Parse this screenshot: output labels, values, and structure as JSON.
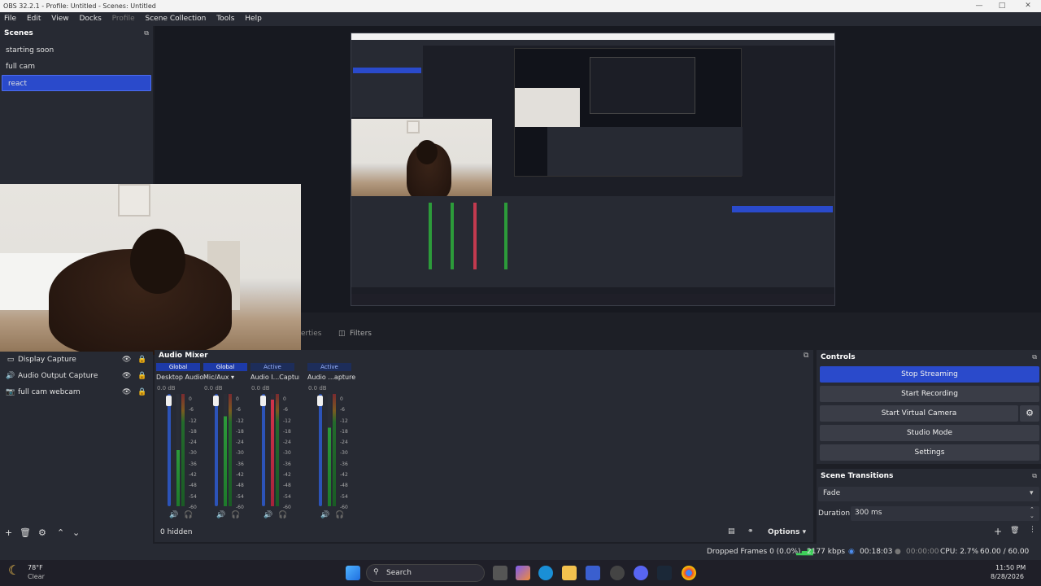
{
  "window": {
    "title": "OBS 32.2.1 - Profile: Untitled - Scenes: Untitled"
  },
  "menu": {
    "file": "File",
    "edit": "Edit",
    "view": "View",
    "docks": "Docks",
    "profile": "Profile",
    "scene_collection": "Scene Collection",
    "tools": "Tools",
    "help": "Help"
  },
  "scenes": {
    "title": "Scenes",
    "items": [
      "starting soon",
      "full cam",
      "react"
    ]
  },
  "tabs": {
    "properties": "erties",
    "filters": "Filters"
  },
  "sources": {
    "items": [
      "Display Capture",
      "Audio Output Capture",
      "full cam webcam"
    ]
  },
  "mixer": {
    "title": "Audio Mixer",
    "hidden": "0 hidden",
    "options": "Options",
    "scale": [
      "0",
      "-6",
      "-12",
      "-18",
      "-24",
      "-30",
      "-36",
      "-42",
      "-48",
      "-54",
      "-60"
    ],
    "channels": [
      {
        "tag": "Global",
        "name": "Desktop Audio",
        "db": "0.0 dB",
        "level": 0.5
      },
      {
        "tag": "Global",
        "name": "Mic/Aux",
        "db": "0.0 dB",
        "level": 0.8
      },
      {
        "tag": "Active",
        "name": "Audio I...Capture",
        "db": "0.0 dB",
        "level": 0.95
      },
      {
        "tag": "Active",
        "name": "Audio ...apture",
        "db": "0.0 dB",
        "level": 0.7
      }
    ]
  },
  "controls": {
    "title": "Controls",
    "stop_streaming": "Stop Streaming",
    "start_recording": "Start Recording",
    "start_virtual_camera": "Start Virtual Camera",
    "studio_mode": "Studio Mode",
    "settings": "Settings"
  },
  "transitions": {
    "title": "Scene Transitions",
    "type": "Fade",
    "duration_label": "Duration",
    "duration_value": "300 ms"
  },
  "status": {
    "dropped_frames": "Dropped Frames 0 (0.0%)",
    "bitrate": "2177 kbps",
    "stream_time": "00:18:03",
    "rec_time": "00:00:00",
    "cpu": "CPU: 2.7%",
    "fps": "60.00 / 60.00 FPS"
  },
  "taskbar": {
    "temp": "78°F",
    "weather": "Clear",
    "search": "Search",
    "time": "11:50 PM",
    "date": "8/28/2026"
  },
  "colors": {
    "accent": "#2a4acb",
    "panel": "#272a33",
    "background": "#1d1f26"
  }
}
